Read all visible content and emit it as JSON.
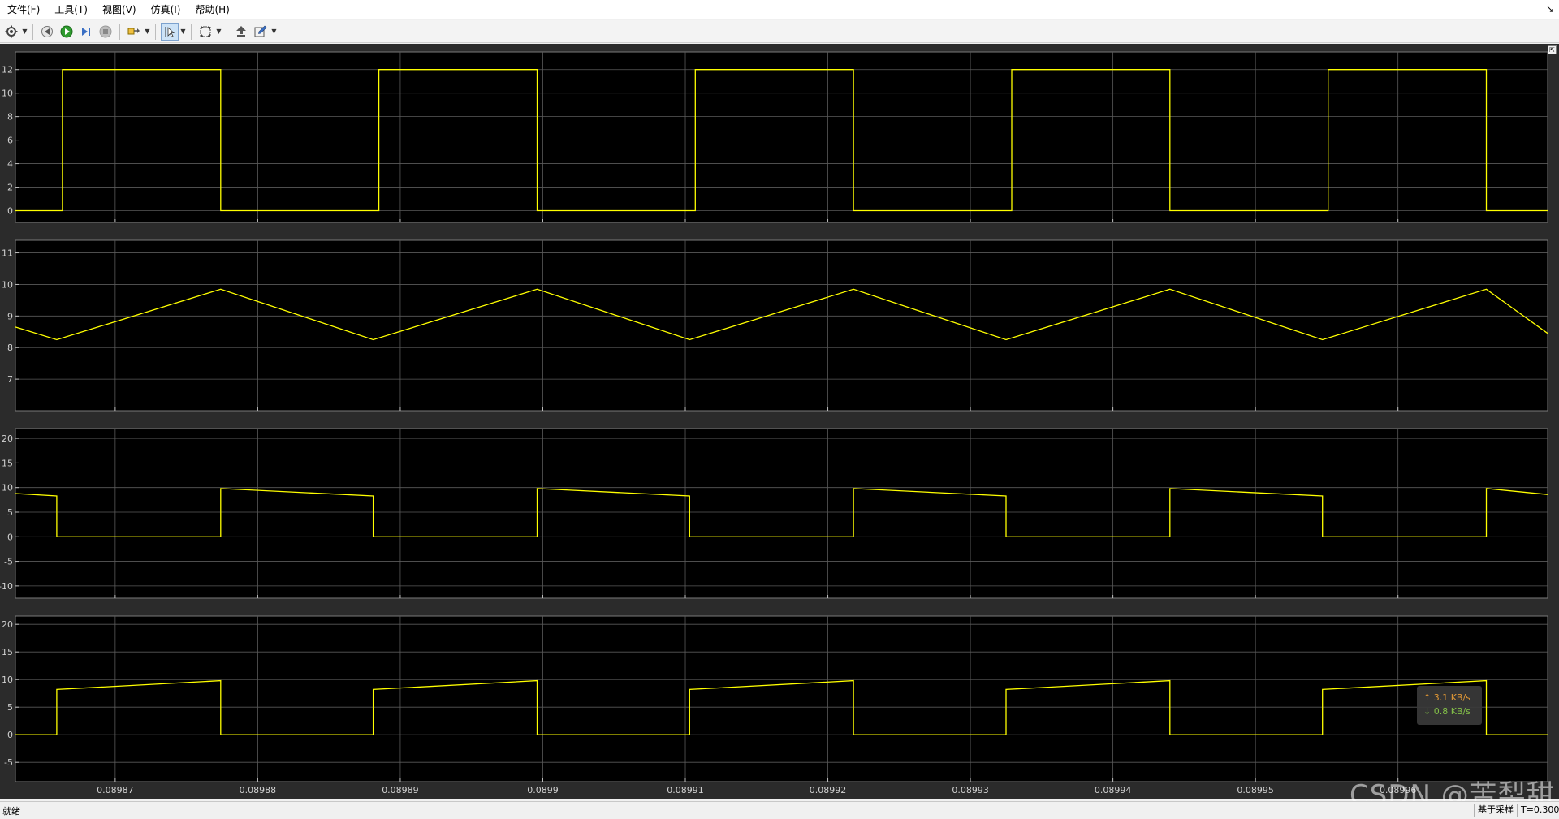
{
  "menu": [
    "文件(F)",
    "工具(T)",
    "视图(V)",
    "仿真(I)",
    "帮助(H)"
  ],
  "menubar_right_icon": "dock-arrow-icon",
  "toolbar": {
    "buttons": [
      {
        "name": "settings-icon",
        "glyph": "⚙",
        "dropdown": true
      },
      {
        "name": "step-back-icon",
        "glyph": "◀",
        "dropdown": false
      },
      {
        "name": "run-icon",
        "glyph": "▶",
        "dropdown": false
      },
      {
        "name": "step-forward-icon",
        "glyph": "▷",
        "dropdown": false
      },
      {
        "name": "stop-icon",
        "glyph": "■",
        "dropdown": false
      },
      {
        "name": "highlight-block-icon",
        "glyph": "⚘",
        "dropdown": true
      },
      {
        "name": "cursor-icon",
        "glyph": "↖",
        "dropdown": true,
        "active": true
      },
      {
        "name": "zoom-fit-icon",
        "glyph": "⛶",
        "dropdown": true
      },
      {
        "name": "lock-axes-icon",
        "glyph": "⇪",
        "dropdown": false
      },
      {
        "name": "edit-style-icon",
        "glyph": "✎",
        "dropdown": true
      }
    ]
  },
  "scope": {
    "background": "#000000",
    "frame_background": "#2b2b2b",
    "grid_color": "#5a5a5a",
    "line_color": "#ffff00",
    "restore_icon": "restore-icon",
    "restore_glyph": "⇱"
  },
  "chart_data": [
    {
      "type": "line",
      "ylim": [
        -1,
        13.5
      ],
      "yticks": [
        "0",
        "2",
        "4",
        "6",
        "8",
        "10",
        "12"
      ],
      "ytick_values": [
        0,
        2,
        4,
        6,
        8,
        10,
        12
      ],
      "grid": true,
      "x": [
        0.089863,
        0.0898663,
        0.0898663,
        0.0898774,
        0.0898774,
        0.0898885,
        0.0898885,
        0.0898996,
        0.0898996,
        0.0899107,
        0.0899107,
        0.0899218,
        0.0899218,
        0.0899329,
        0.0899329,
        0.089944,
        0.089944,
        0.0899551,
        0.0899551,
        0.0899662,
        0.0899662,
        0.0899705
      ],
      "y": [
        0,
        0,
        12,
        12,
        0,
        0,
        12,
        12,
        0,
        0,
        12,
        12,
        0,
        0,
        12,
        12,
        0,
        0,
        12,
        12,
        0,
        0
      ]
    },
    {
      "type": "line",
      "ylim": [
        6,
        11.4
      ],
      "yticks": [
        "7",
        "8",
        "9",
        "10",
        "11"
      ],
      "ytick_values": [
        7,
        8,
        9,
        10,
        11
      ],
      "grid": true,
      "x": [
        0.089863,
        0.0898659,
        0.0898774,
        0.0898881,
        0.0898996,
        0.0899103,
        0.0899218,
        0.0899325,
        0.089944,
        0.0899547,
        0.0899662,
        0.0899705
      ],
      "y": [
        8.65,
        8.25,
        9.85,
        8.25,
        9.85,
        8.25,
        9.85,
        8.25,
        9.85,
        8.25,
        9.85,
        8.45
      ]
    },
    {
      "type": "line",
      "ylim": [
        -12.5,
        22
      ],
      "yticks": [
        "-10",
        "-5",
        "0",
        "5",
        "10",
        "15",
        "20"
      ],
      "ytick_values": [
        -10,
        -5,
        0,
        5,
        10,
        15,
        20
      ],
      "grid": true,
      "x": [
        0.089863,
        0.0898659,
        0.0898659,
        0.0898774,
        0.0898774,
        0.0898881,
        0.0898881,
        0.0898996,
        0.0898996,
        0.0899103,
        0.0899103,
        0.0899218,
        0.0899218,
        0.0899325,
        0.0899325,
        0.089944,
        0.089944,
        0.0899547,
        0.0899547,
        0.0899662,
        0.0899662,
        0.0899705
      ],
      "y": [
        8.8,
        8.3,
        0,
        0,
        9.8,
        8.3,
        0,
        0,
        9.8,
        8.3,
        0,
        0,
        9.8,
        8.3,
        0,
        0,
        9.8,
        8.3,
        0,
        0,
        9.8,
        8.6
      ]
    },
    {
      "type": "line",
      "ylim": [
        -8.5,
        21.5
      ],
      "yticks": [
        "-5",
        "0",
        "5",
        "10",
        "15",
        "20"
      ],
      "ytick_values": [
        -5,
        0,
        5,
        10,
        15,
        20
      ],
      "xticks": [
        "0.08987",
        "0.08988",
        "0.08989",
        "0.0899",
        "0.08991",
        "0.08992",
        "0.08993",
        "0.08994",
        "0.08995",
        "0.08996"
      ],
      "xtick_values": [
        0.08987,
        0.08988,
        0.08989,
        0.0899,
        0.08991,
        0.08992,
        0.08993,
        0.08994,
        0.08995,
        0.08996
      ],
      "grid": true,
      "x": [
        0.089863,
        0.0898659,
        0.0898659,
        0.0898774,
        0.0898774,
        0.0898881,
        0.0898881,
        0.0898996,
        0.0898996,
        0.0899103,
        0.0899103,
        0.0899218,
        0.0899218,
        0.0899325,
        0.0899325,
        0.089944,
        0.089944,
        0.0899547,
        0.0899547,
        0.0899662,
        0.0899662,
        0.0899705
      ],
      "y": [
        0,
        0,
        8.2,
        9.8,
        0,
        0,
        8.2,
        9.8,
        0,
        0,
        8.2,
        9.8,
        0,
        0,
        8.2,
        9.8,
        0,
        0,
        8.2,
        9.8,
        0,
        0
      ]
    }
  ],
  "xlim": [
    0.089863,
    0.0899705
  ],
  "network_monitor": {
    "up": "↑ 3.1 KB/s",
    "down": "↓ 0.8 KB/s"
  },
  "statusbar": {
    "left": "就绪",
    "sample": "基于采样",
    "time": "T=0.300"
  },
  "watermark": "CSDN @苦梨甜"
}
